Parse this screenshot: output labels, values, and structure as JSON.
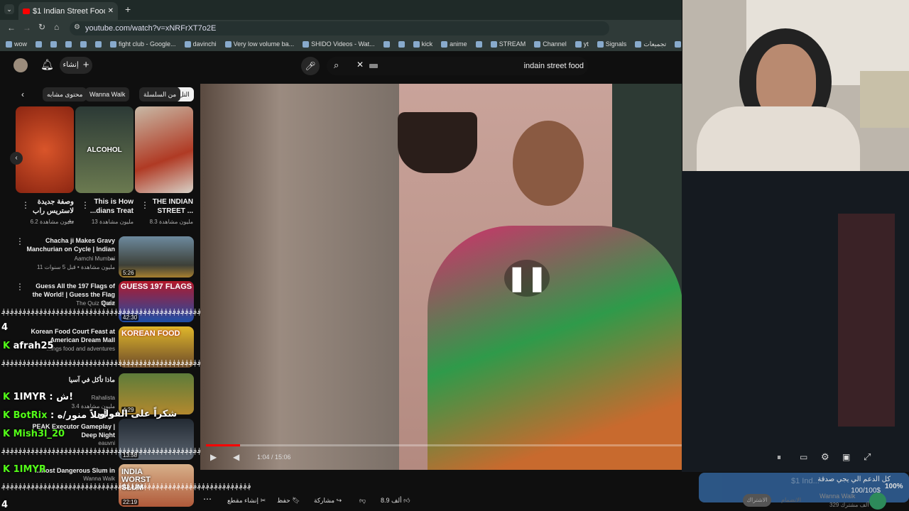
{
  "browser": {
    "tab_title": "$1 Indian Street Food",
    "url": "youtube.com/watch?v=xNRFrXT7o2E",
    "bookmarks": [
      "wow",
      "",
      "",
      "",
      "",
      "",
      "fight club - Google...",
      "davinchi",
      "Very low volume ba...",
      "SHIDO Videos - Wat...",
      "",
      "",
      "kick",
      "anime",
      "",
      "STREAM",
      "Channel",
      "yt",
      "Signals",
      "تجميعات",
      "ani"
    ]
  },
  "header": {
    "create_label": "إنشاء",
    "search_value": "indain street food"
  },
  "chips": [
    "التل",
    "من السلسلة",
    "Wanna Walk",
    "محتوى مشابه"
  ],
  "shorts": [
    {
      "title": "THE INDIAN STREET ...",
      "views": "8.3 مليون مشاهدة"
    },
    {
      "title": "This is How ...dians Treat",
      "views": "13 مليون مشاهدة"
    },
    {
      "title": "وصفة جديدة لاستريس راب ...",
      "views": "6.2 مليون مشاهدة"
    }
  ],
  "thumb_labels": {
    "alcohol": "ALCOHOL",
    "flags": "GUESS 197 FLAGS",
    "korean": "KOREAN FOOD",
    "india": "INDIA WORST SLUM"
  },
  "videos": [
    {
      "title": "Chacha ji Makes Gravy Manchurian on Cycle | Indian ...",
      "channel": "Aamchi Mumbai",
      "meta": "11 مليون مشاهدة • قبل 5 سنوات",
      "duration": "5:26"
    },
    {
      "title": "Guess All the 197 Flags of the World! | Guess the Flag Quiz",
      "channel": "The Quiz Place",
      "meta": "",
      "duration": "42:30"
    },
    {
      "title": "Korean Food Court Feast at American Dream Mall",
      "channel": "...ings food and adventures",
      "meta": "",
      "duration": ""
    },
    {
      "title": "ماذا تأكل في آسيا",
      "channel": "Rahalista",
      "meta": "3.4 مليون مشاهدة",
      "duration": "4:29"
    },
    {
      "title": "PEAK Executor Gameplay | Deep Night",
      "channel": "eauvni",
      "meta": "",
      "duration": "13:58"
    },
    {
      "title": "...Most Dangerous Slum in",
      "channel": "Wanna Walk",
      "meta": "",
      "duration": "22:19"
    }
  ],
  "chat": [
    {
      "user": "afrah25",
      "message": ""
    },
    {
      "user": "1IMYR",
      "message": ": ش!"
    },
    {
      "user": "BotRix",
      "message": ": أهلاً منور/ه"
    },
    {
      "user": "Mish3l_20",
      "message": ""
    },
    {
      "user": "1IMYR",
      "message": ""
    }
  ],
  "chat_overlay": {
    "wave": "؋؋؋؋؋؋؋؋؋؋؋؋؋؋؋؋؋؋؋؋؋؋؋؋؋؋؋؋؋؋؋؋؋؋؋؋؋؋؋؋؋؋؋؋؋؋؋؋؋؋؋؋؋؋؋؋؋؋؋؋",
    "thanks": "شكراً على الفولو",
    "badge": "4"
  },
  "player": {
    "time": "1:04 / 15:06",
    "progress": 0.071
  },
  "actions": {
    "likes": "8.9 ألف",
    "share": "مشاركة",
    "clip": "إنشاء مقطع",
    "save": "حفظ"
  },
  "donation": {
    "title": "كل الدعم الي يجي صدقة",
    "amount": "100/100$",
    "percent": "100%",
    "line2": "$1 Ind...",
    "channel": "Wanna Walk",
    "subs": "329 ألف مشترك",
    "join": "الاشتراك",
    "tab": "الانضمام"
  },
  "colors": {
    "youtube_red": "#ff0000",
    "kick_green": "#53fc18",
    "donation_blue": "#2f5c8f"
  }
}
